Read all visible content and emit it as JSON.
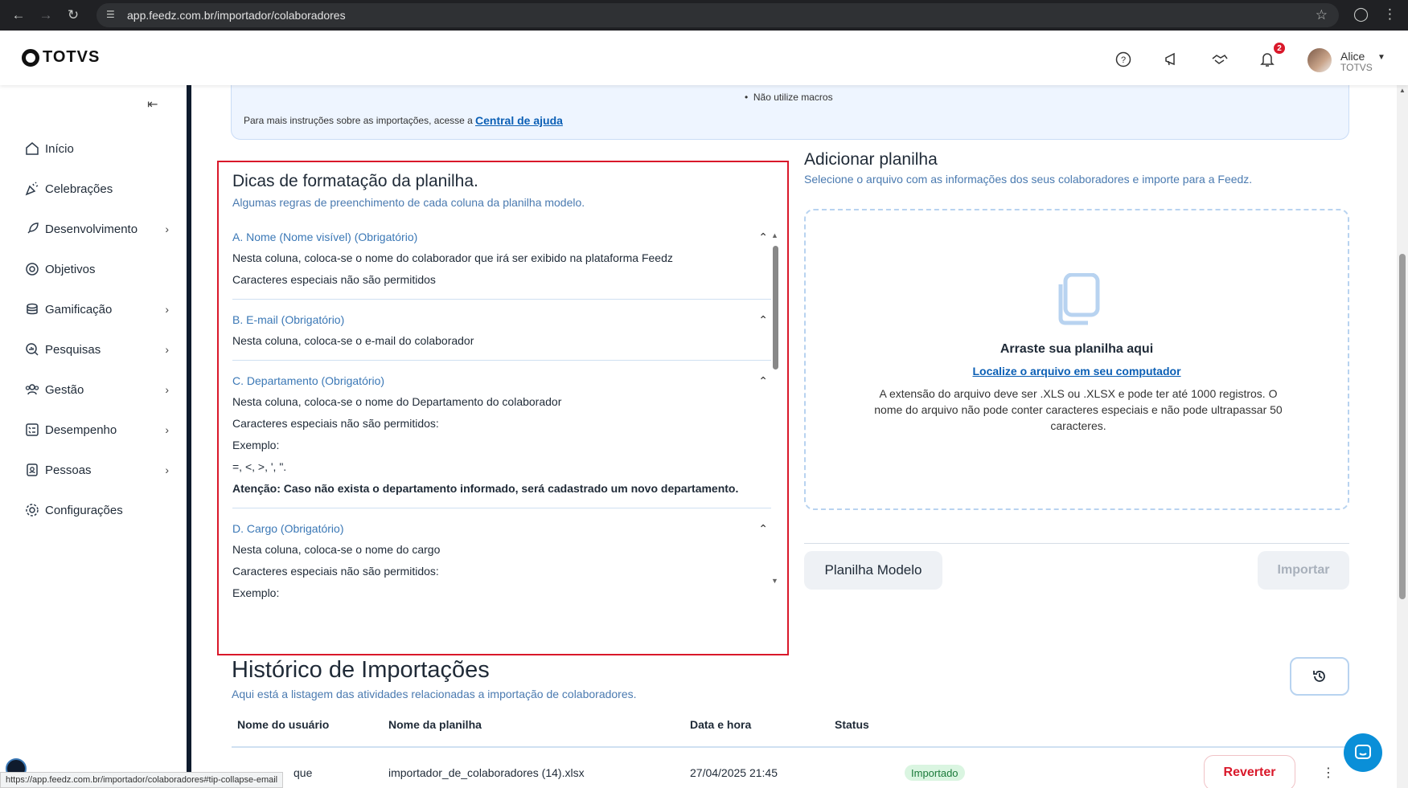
{
  "browser": {
    "url": "app.feedz.com.br/importador/colaboradores",
    "status_url": "https://app.feedz.com.br/importador/colaboradores#tip-collapse-email"
  },
  "header": {
    "logo": "TOTVS",
    "notification_count": "2",
    "user_name": "Alice",
    "user_company": "TOTVS",
    "icons": [
      "help-icon",
      "megaphone-icon",
      "handshake-icon",
      "bell-icon"
    ]
  },
  "sidebar": {
    "items": [
      {
        "label": "Início",
        "icon": "home-icon",
        "chevron": false
      },
      {
        "label": "Celebrações",
        "icon": "confetti-icon",
        "chevron": false
      },
      {
        "label": "Desenvolvimento",
        "icon": "rocket-icon",
        "chevron": true
      },
      {
        "label": "Objetivos",
        "icon": "target-icon",
        "chevron": false
      },
      {
        "label": "Gamificação",
        "icon": "coins-icon",
        "chevron": true
      },
      {
        "label": "Pesquisas",
        "icon": "search-chart-icon",
        "chevron": true
      },
      {
        "label": "Gestão",
        "icon": "people-icon",
        "chevron": true
      },
      {
        "label": "Desempenho",
        "icon": "checklist-icon",
        "chevron": true
      },
      {
        "label": "Pessoas",
        "icon": "badge-icon",
        "chevron": true
      },
      {
        "label": "Configurações",
        "icon": "gear-icon",
        "chevron": false
      }
    ]
  },
  "info": {
    "bullet": "Não utilize macros",
    "text": "Para mais instruções sobre as importações, acesse a",
    "link": "Central de ajuda"
  },
  "tips": {
    "title": "Dicas de formatação da planilha.",
    "subtitle": "Algumas regras de preenchimento de cada coluna da planilha modelo.",
    "items": [
      {
        "title": "A. Nome (Nome visível) (Obrigatório)",
        "lines": [
          "Nesta coluna, coloca-se o nome do colaborador que irá ser exibido na plataforma Feedz",
          "Caracteres especiais não são permitidos"
        ]
      },
      {
        "title": "B. E-mail (Obrigatório)",
        "lines": [
          "Nesta coluna, coloca-se o e-mail do colaborador"
        ]
      },
      {
        "title": "C. Departamento (Obrigatório)",
        "lines": [
          "Nesta coluna, coloca-se o nome do Departamento do colaborador",
          "Caracteres especiais não são permitidos:",
          "Exemplo:",
          "=, <, >, ', \"."
        ],
        "bold": "Atenção: Caso não exista o departamento informado, será cadastrado um novo departamento."
      },
      {
        "title": "D. Cargo (Obrigatório)",
        "lines": [
          "Nesta coluna, coloca-se o nome do cargo",
          "Caracteres especiais não são permitidos:",
          "Exemplo:"
        ]
      }
    ]
  },
  "upload": {
    "title": "Adicionar planilha",
    "subtitle": "Selecione o arquivo com as informações dos seus colaboradores e importe para a Feedz.",
    "drop_title": "Arraste sua planilha aqui",
    "drop_link": "Localize o arquivo em seu computador",
    "drop_note": "A extensão do arquivo deve ser .XLS ou .XLSX e pode ter até 1000 registros. O nome do arquivo não pode conter caracteres especiais e não pode ultrapassar 50 caracteres.",
    "model_button": "Planilha Modelo",
    "import_button": "Importar"
  },
  "history": {
    "title": "Histórico de Importações",
    "subtitle": "Aqui está a listagem das atividades relacionadas a importação de colaboradores.",
    "columns": [
      "Nome do usuário",
      "Nome da planilha",
      "Data e hora",
      "Status"
    ],
    "rows": [
      {
        "user": "que",
        "file": "importador_de_colaboradores (14).xlsx",
        "date": "27/04/2025 21:45",
        "status": "Importado",
        "action": "Reverter"
      }
    ]
  }
}
